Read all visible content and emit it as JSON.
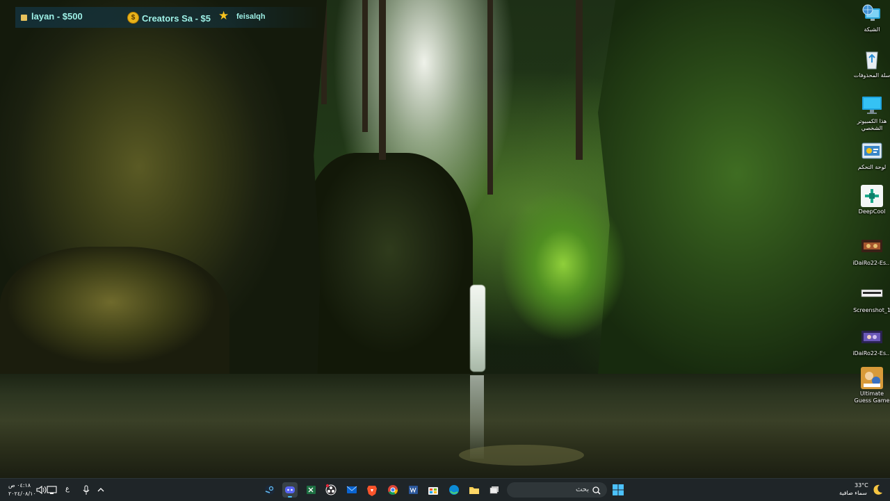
{
  "ticker": {
    "item1": "layan - $500",
    "coin_symbol": "$",
    "item2": "Creators Sa - $5",
    "user": "feisalqh"
  },
  "desktop_icons": [
    {
      "name": "network",
      "label": "الشبكة",
      "icon": "network-icon"
    },
    {
      "name": "recycle-bin",
      "label": "سلة المحذوفات",
      "icon": "recycle-bin-icon"
    },
    {
      "name": "this-pc",
      "label": "هذا الكمبيوتر الشخصي",
      "icon": "monitor-icon"
    },
    {
      "name": "control-panel",
      "label": "لوحة التحكم",
      "icon": "control-panel-icon"
    },
    {
      "name": "deepcool",
      "label": "DeepCool",
      "icon": "deepcool-icon"
    },
    {
      "name": "idairo22-1",
      "label": "iDaiRo22-Es...",
      "icon": "image-thumbnail-icon"
    },
    {
      "name": "screenshot-1",
      "label": "Screenshot_1",
      "icon": "image-thumbnail-icon"
    },
    {
      "name": "idairo22-2",
      "label": "iDaiRo22-Es...",
      "icon": "image-thumbnail-icon"
    },
    {
      "name": "ultimate-guess-game",
      "label": "Ultimate Guess Game",
      "icon": "game-icon"
    }
  ],
  "taskbar": {
    "weather_temp": "33°C",
    "weather_desc": "سماء صافية",
    "search_placeholder": "بحث",
    "time": "٠٤:١٨ ص",
    "date": "٢٠٢٤/٠٨/١٠",
    "lang": "ع",
    "pinned": [
      "steam-icon",
      "discord-icon",
      "excel-icon",
      "obs-icon",
      "mail-icon",
      "brave-icon",
      "chrome-icon",
      "word-icon",
      "store-icon",
      "edge-icon",
      "file-explorer-icon",
      "task-view-icon"
    ],
    "colors": {
      "bar": "#1f2528",
      "accent": "#4cc2ff"
    }
  }
}
